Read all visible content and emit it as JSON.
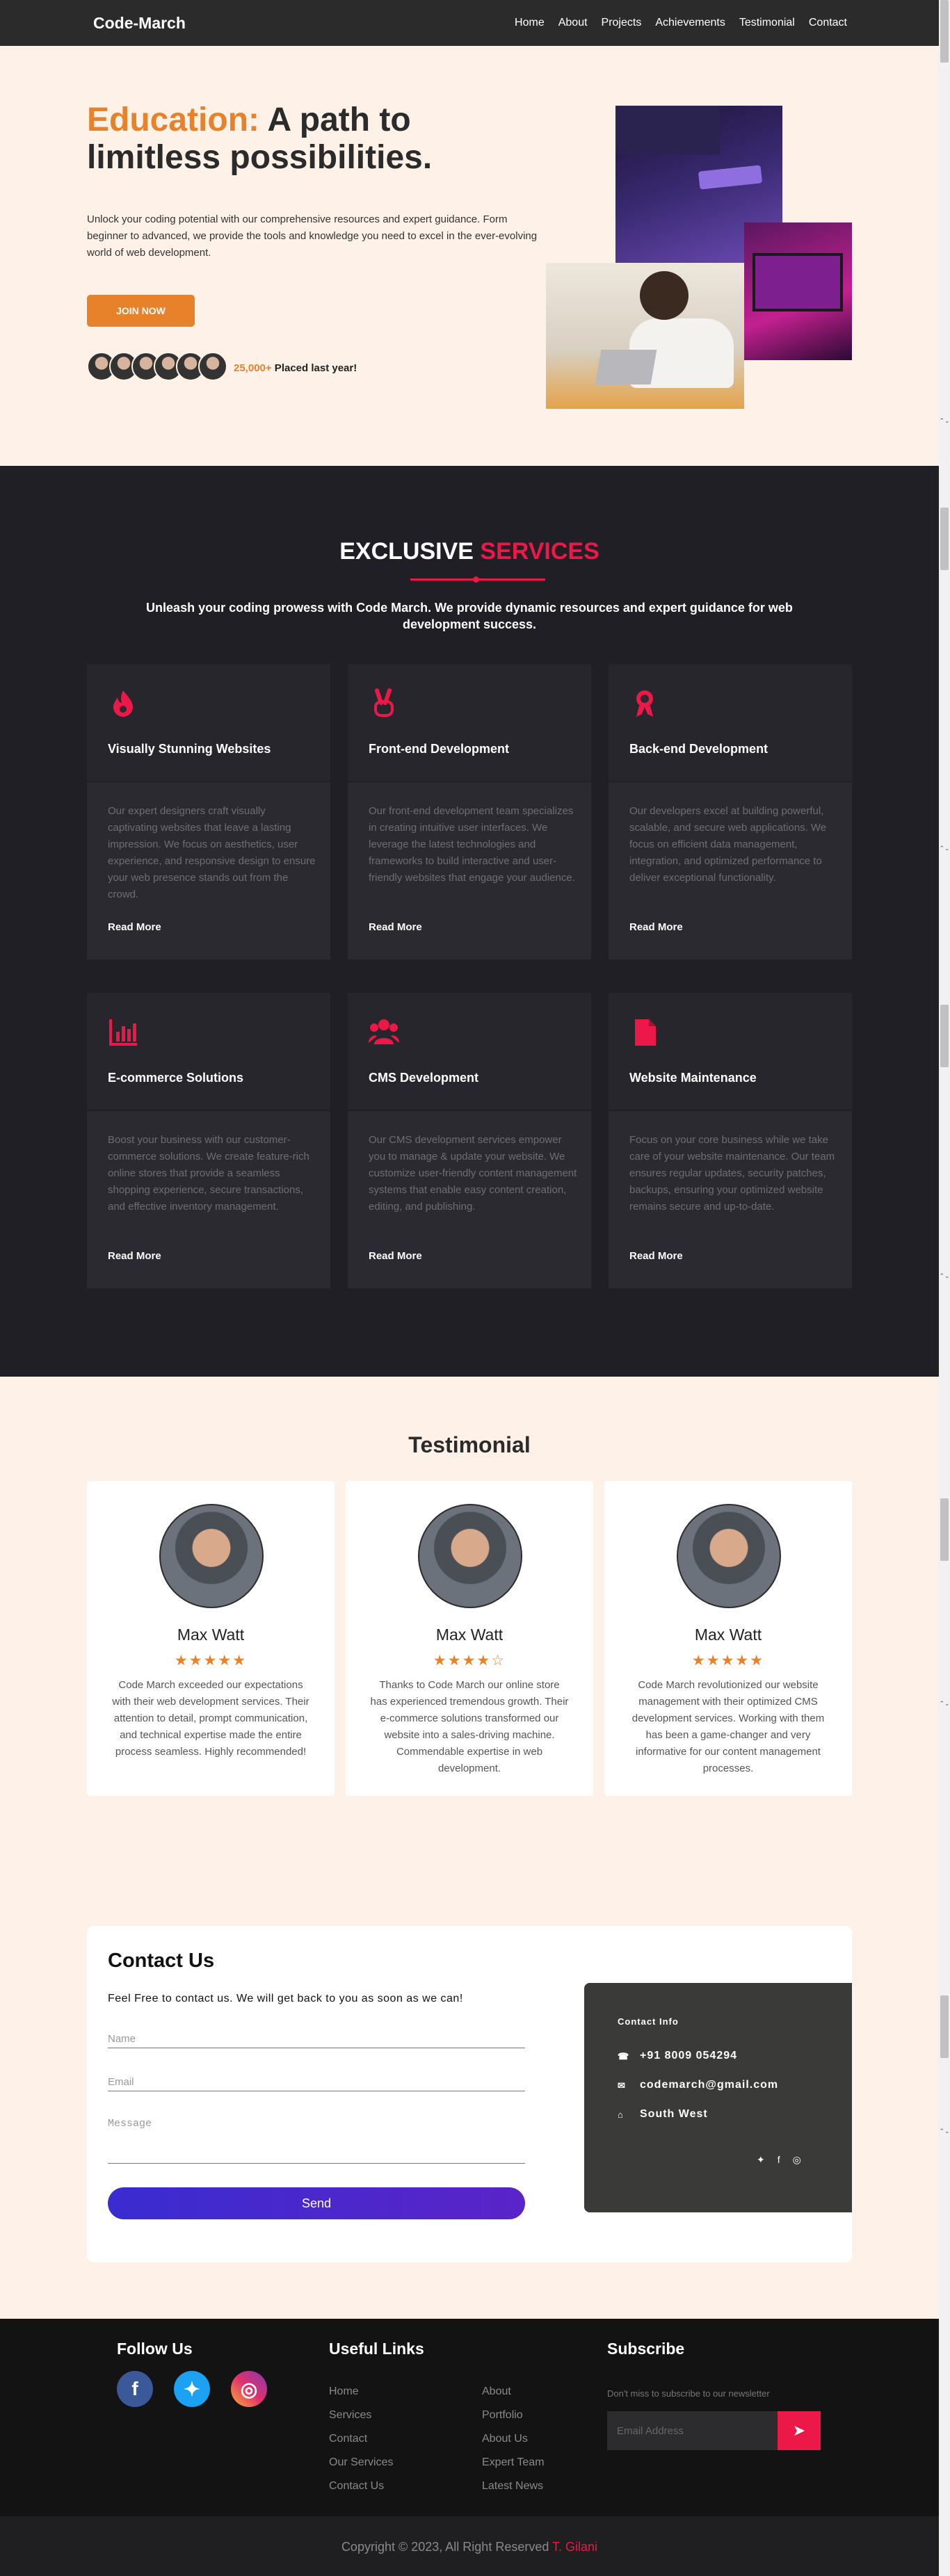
{
  "nav": {
    "brand": "Code-March",
    "links": [
      "Home",
      "About",
      "Projects",
      "Achievements",
      "Testimonial",
      "Contact"
    ]
  },
  "hero": {
    "title_accent": "Education:",
    "title_rest": " A path to limitless possibilities.",
    "description": "Unlock your coding potential with our comprehensive resources and expert guidance. Form beginner to advanced, we provide the tools and knowledge you need to excel in the ever-evolving world of web development.",
    "join_label": "JOIN NOW",
    "placed_count": "25,000+",
    "placed_text": " Placed last year!"
  },
  "services": {
    "title_white": "EXCLUSIVE ",
    "title_red": "SERVICES",
    "subtitle": "Unleash your coding prowess with Code March. We provide dynamic resources and expert guidance for web development success.",
    "read_more": "Read More",
    "cards": [
      {
        "icon": "fire-icon",
        "title": "Visually Stunning Websites",
        "desc": "Our expert designers craft visually captivating websites that leave a lasting impression. We focus on aesthetics, user experience, and responsive design to ensure your web presence stands out from the crowd."
      },
      {
        "icon": "peace-hand-icon",
        "title": "Front-end Development",
        "desc": "Our front-end development team specializes in creating intuitive user interfaces. We leverage the latest technologies and frameworks to build interactive and user-friendly websites that engage your audience."
      },
      {
        "icon": "award-icon",
        "title": "Back-end Development",
        "desc": "Our developers excel at building powerful, scalable, and secure web applications. We focus on efficient data management, integration, and optimized performance to deliver exceptional functionality."
      },
      {
        "icon": "bar-chart-icon",
        "title": "E-commerce Solutions",
        "desc": "Boost your business with our customer-commerce solutions. We create feature-rich online stores that provide a seamless shopping experience, secure transactions, and effective inventory management."
      },
      {
        "icon": "users-icon",
        "title": "CMS Development",
        "desc": "Our CMS development services empower you to manage & update your website. We customize user-friendly content management systems that enable easy content creation, editing, and publishing."
      },
      {
        "icon": "file-icon",
        "title": "Website Maintenance",
        "desc": "Focus on your core business while we take care of your website maintenance. Our team ensures regular updates, security patches, backups, ensuring your optimized website remains secure and up-to-date."
      }
    ]
  },
  "testimonial": {
    "title": "Testimonial",
    "items": [
      {
        "name": "Max Watt",
        "rating": 5,
        "stars": "★★★★★",
        "text": "Code March exceeded our expectations with their web development services. Their attention to detail, prompt communication, and technical expertise made the entire process seamless. Highly recommended!"
      },
      {
        "name": "Max Watt",
        "rating": 4,
        "stars": "★★★★☆",
        "text": "Thanks to Code March our online store has experienced tremendous growth. Their e-commerce solutions transformed our website into a sales-driving machine. Commendable expertise in web development."
      },
      {
        "name": "Max Watt",
        "rating": 5,
        "stars": "★★★★★",
        "text": "Code March revolutionized our website management with their optimized CMS development services. Working with them has been a game-changer and very informative for our content management processes."
      }
    ]
  },
  "contact": {
    "title": "Contact Us",
    "subtitle": "Feel Free to contact us. We will get back to you as soon as we can!",
    "name_placeholder": "Name",
    "email_placeholder": "Email",
    "message_placeholder": "Message",
    "send_label": "Send",
    "info_title": "Contact Info",
    "phone": "+91 8009 054294",
    "email": "codemarch@gmail.com",
    "location": "South West"
  },
  "footer": {
    "follow_title": "Follow Us",
    "links_title": "Useful Links",
    "subscribe_title": "Subscribe",
    "links_col1": [
      "Home",
      "Services",
      "Contact",
      "Our Services",
      "Contact Us"
    ],
    "links_col2": [
      "About",
      "Portfolio",
      "About Us",
      "Expert Team",
      "Latest News"
    ],
    "subscribe_note": "Don't miss to subscribe to our newsletter",
    "email_placeholder": "Email Address",
    "copyright": "Copyright © 2023, All Right Reserved ",
    "author": "T. Gilani"
  }
}
